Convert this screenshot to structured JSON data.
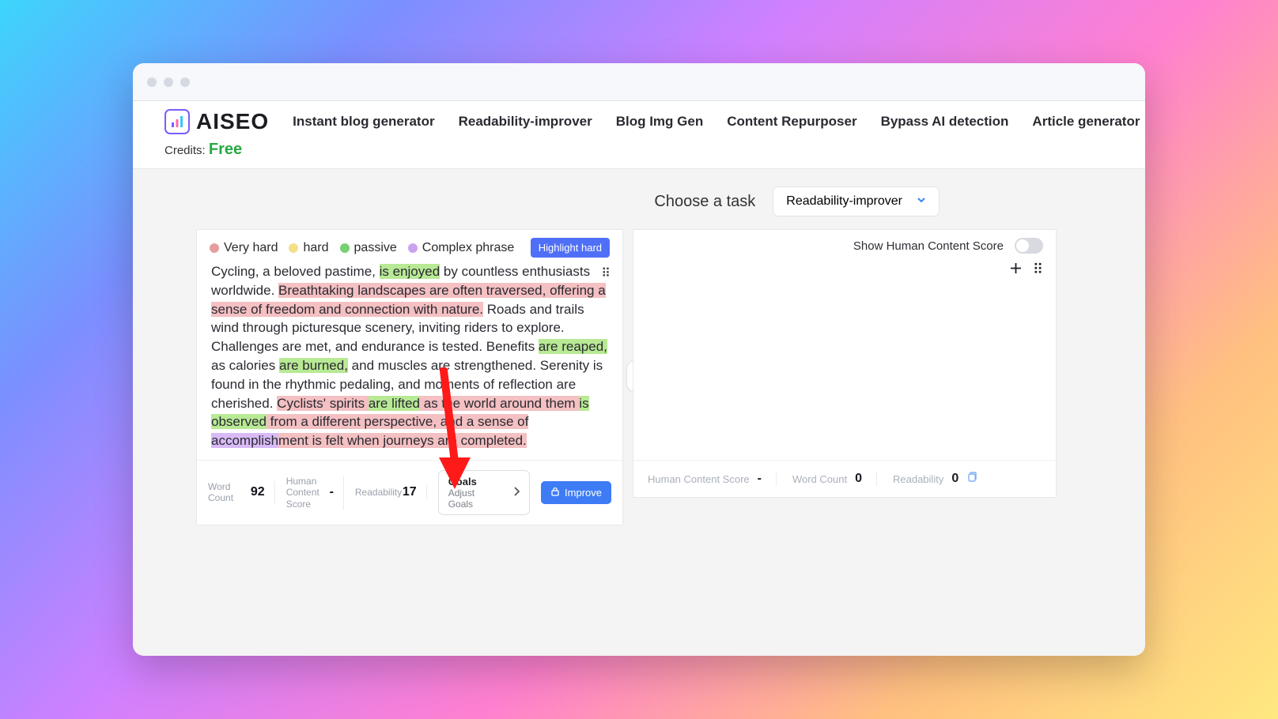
{
  "brand": "AISEO",
  "nav": {
    "items": [
      "Instant blog generator",
      "Readability-improver",
      "Blog Img Gen",
      "Content Repurposer",
      "Bypass AI detection",
      "Article generator"
    ]
  },
  "credits": {
    "label": "Credits:",
    "value": "Free"
  },
  "task": {
    "label": "Choose a task",
    "selected": "Readability-improver"
  },
  "legend": {
    "veryhard": {
      "label": "Very hard",
      "color": "#e49e9f"
    },
    "hard": {
      "label": "hard",
      "color": "#f4e08b"
    },
    "passive": {
      "label": "passive",
      "color": "#77d072"
    },
    "complex": {
      "label": "Complex phrase",
      "color": "#c9a3ef"
    },
    "highlight_button": "Highlight hard"
  },
  "editor": {
    "segments": [
      {
        "t": "Cycling, a beloved pastime, "
      },
      {
        "t": "is enjoyed",
        "hl": "passive"
      },
      {
        "t": " by countless enthusiasts worldwide. "
      },
      {
        "t": "Breathtaking landscapes are often traversed, offering a sense of freedom and connection with nature.",
        "hl": "veryhard"
      },
      {
        "t": " Roads and trails wind through picturesque scenery, inviting riders to explore. Challenges are met, and endurance is tested. Benefits "
      },
      {
        "t": "are reaped,",
        "hl": "passive"
      },
      {
        "t": " as calories "
      },
      {
        "t": "are burned,",
        "hl": "passive"
      },
      {
        "t": " and muscles are strengthened. Serenity is found in the rhythmic pedaling, and moments of reflection are cherished. "
      },
      {
        "t": "Cyclists' spirits ",
        "hl": "veryhard"
      },
      {
        "t": "are lifted",
        "hl": "passive"
      },
      {
        "t": " as the world around them ",
        "hl": "veryhard"
      },
      {
        "t": "is observed",
        "hl": "passive"
      },
      {
        "t": " from a different perspective, and a sense of ",
        "hl": "veryhard"
      },
      {
        "t": "accomplish",
        "hl": "complex"
      },
      {
        "t": "ment is felt when journeys are completed.",
        "hl": "veryhard"
      }
    ]
  },
  "metrics": {
    "wordcount_label": "Word Count",
    "wordcount": "92",
    "hcs_label": "Human Content Score",
    "hcs": "-",
    "readability_label": "Readability",
    "readability": "17",
    "goals_title": "Goals",
    "goals_sub": "Adjust Goals",
    "improve": "Improve"
  },
  "right": {
    "show_hcs_label": "Show Human Content Score",
    "hcs_label": "Human Content Score",
    "hcs": "-",
    "wordcount_label": "Word Count",
    "wordcount": "0",
    "readability_label": "Readability",
    "readability": "0"
  }
}
